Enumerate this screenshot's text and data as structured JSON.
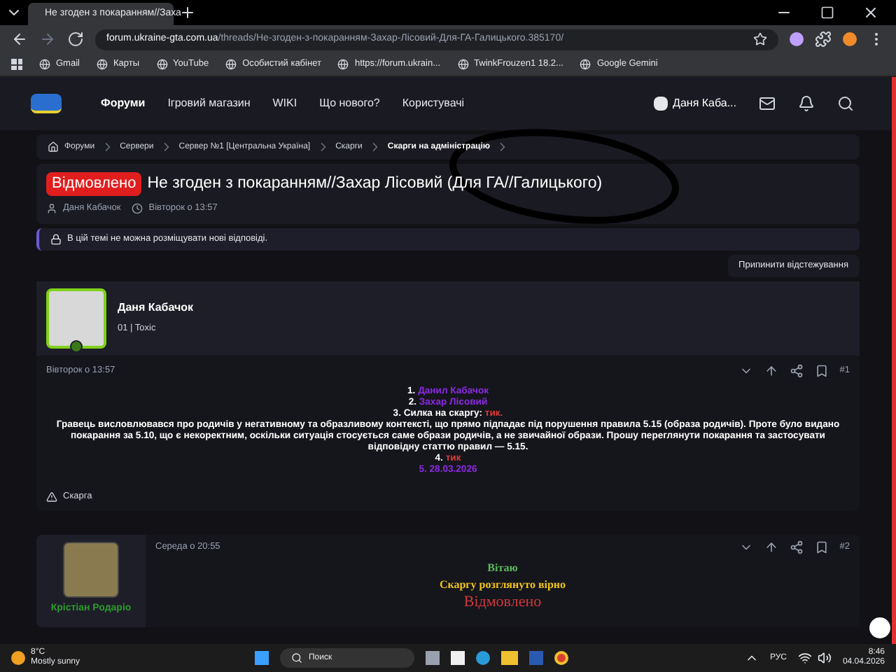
{
  "browser": {
    "tab_title": "Не згоден з покаранням//Заха",
    "url_host": "forum.ukraine-gta.com.ua",
    "url_path": "/threads/Не-згоден-з-покаранням-Захар-Лісовий-Для-ГА-Галицького.385170/",
    "bookmarks": [
      "Gmail",
      "Карты",
      "YouTube",
      "Особистий кабінет",
      "https://forum.ukrain...",
      "TwinkFrouzen1 18.2...",
      "Google Gemini"
    ]
  },
  "nav": {
    "items": [
      {
        "label": "Форуми",
        "selected": true
      },
      {
        "label": "Ігровий магазин",
        "selected": false
      },
      {
        "label": "WIKI",
        "selected": false
      },
      {
        "label": "Що нового?",
        "selected": false
      },
      {
        "label": "Користувачі",
        "selected": false
      }
    ],
    "user": "Даня Каба..."
  },
  "breadcrumbs": [
    "Форуми",
    "Сервери",
    "Сервер №1 [Центральна Україна]",
    "Скарги",
    "Скарги на адміністрацію"
  ],
  "thread": {
    "prefix": "Відмовлено",
    "title": "Не згоден з покаранням//Захар Лісовий (Для ГА//Галицького)",
    "author": "Даня Кабачок",
    "date": "Вівторок о 13:57",
    "notice": "В цій темі не можна розміщувати нові відповіді.",
    "unwatch": "Припинити відстежування"
  },
  "posts": [
    {
      "author": "Даня Кабачок",
      "user_title": "01 | Toxic",
      "date": "Вівторок о 13:57",
      "number": "#1",
      "report": "Скарга",
      "lines": [
        [
          {
            "text": "1. ",
            "color": "#ffffff"
          },
          {
            "text": "Данил Кабачок",
            "color": "#8b2be2"
          }
        ],
        [
          {
            "text": "2. ",
            "color": "#ffffff"
          },
          {
            "text": "Захар Лісовий",
            "color": "#8b2be2"
          }
        ],
        [
          {
            "text": "3. Силка на скаргу: ",
            "color": "#ffffff"
          },
          {
            "text": "тик.",
            "color": "#e03a3a"
          }
        ],
        [
          {
            "text": "Гравець висловлювався про родичів у негативному та образливому контексті, що прямо підпадає під порушення правила 5.15 (образа родичів). Проте було видано покарання за 5.10, що є некоректним, оскільки ситуація стосується саме образи родичів, а не звичайної образи. Прошу переглянути покарання та застосувати відповідну статтю правил — 5.15.",
            "color": "#ffffff"
          }
        ],
        [
          {
            "text": "4. ",
            "color": "#ffffff"
          },
          {
            "text": "тик",
            "color": "#e03a3a"
          }
        ],
        [
          {
            "text": "5. 28.03.2026",
            "color": "#8b2be2"
          }
        ]
      ]
    },
    {
      "author": "Крістіан Родаріо",
      "date": "Середа о 20:55",
      "number": "#2",
      "lines": [
        [
          {
            "text": "Вітаю",
            "color": "#5cb85c"
          }
        ],
        [
          {
            "text": "Скаргу розглянуто вірно",
            "color": "#f0c419"
          }
        ],
        [
          {
            "text": "Відмовлено",
            "color": "#d03a3a"
          }
        ]
      ]
    }
  ],
  "taskbar": {
    "temperature": "8°C",
    "weather": "Mostly sunny",
    "search": "Поиск",
    "language": "РУС",
    "time": "8:46",
    "date": "04.04.2026"
  }
}
